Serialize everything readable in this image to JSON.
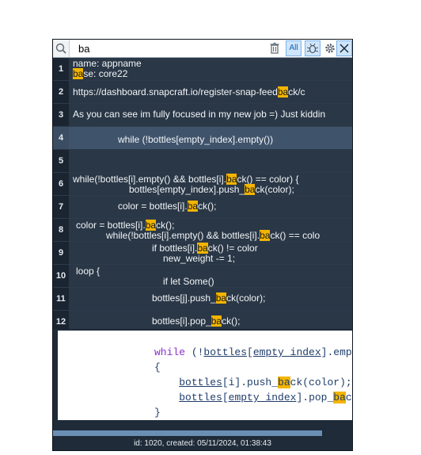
{
  "search": {
    "value": "ba",
    "all_label": "All"
  },
  "icons": {
    "search": "search-icon",
    "trash": "trash-icon",
    "bug": "bug-icon",
    "gear": "gear-icon",
    "close": "close-icon"
  },
  "rows": [
    {
      "num": "1",
      "lines": [
        [
          {
            "t": "name: appname"
          }
        ],
        [
          {
            "t": "ba",
            "h": true
          },
          {
            "t": "se: core22"
          }
        ]
      ]
    },
    {
      "num": "2",
      "lines": [
        [
          {
            "t": "https://dashboard.snapcraft.io/register-snap-feed"
          },
          {
            "t": "ba",
            "h": true
          },
          {
            "t": "ck/c"
          }
        ]
      ]
    },
    {
      "num": "3",
      "lines": [
        [
          {
            "t": "As you can see im fully focused in my new job =) Just kiddin"
          }
        ]
      ]
    },
    {
      "num": "4",
      "lines": [
        [
          {
            "t": "while (!bottles[empty_index].empty())"
          }
        ]
      ]
    },
    {
      "num": "5",
      "lines": []
    },
    {
      "num": "6",
      "lines": [
        [
          {
            "t": "while(!bottles[i].empty() && bottles[i]."
          },
          {
            "t": "ba",
            "h": true
          },
          {
            "t": "ck() == color) {"
          }
        ],
        [
          {
            "t": "bottles[empty_index].push_"
          },
          {
            "t": "ba",
            "h": true
          },
          {
            "t": "ck(color);"
          }
        ]
      ]
    },
    {
      "num": "7",
      "lines": [
        [
          {
            "t": "color = bottles[i]."
          },
          {
            "t": "ba",
            "h": true
          },
          {
            "t": "ck();"
          }
        ]
      ]
    },
    {
      "num": "8",
      "lines": [
        [
          {
            "t": "color = bottles[i]."
          },
          {
            "t": "ba",
            "h": true
          },
          {
            "t": "ck();"
          }
        ],
        [
          {
            "t": "while(!bottles[i].empty() && bottles[i]."
          },
          {
            "t": "ba",
            "h": true
          },
          {
            "t": "ck() == colo"
          }
        ]
      ]
    },
    {
      "num": "9",
      "lines": [
        [
          {
            "t": "if bottles[i]."
          },
          {
            "t": "ba",
            "h": true
          },
          {
            "t": "ck() != color"
          }
        ],
        [
          {
            "t": "new_weight -= 1;"
          }
        ]
      ]
    },
    {
      "num": "10",
      "lines": [
        [
          {
            "t": "loop {"
          }
        ],
        [
          {
            "t": "if let Some()"
          }
        ]
      ]
    },
    {
      "num": "11",
      "lines": [
        [
          {
            "t": "bottles[j].push_"
          },
          {
            "t": "ba",
            "h": true
          },
          {
            "t": "ck(color);"
          }
        ]
      ]
    },
    {
      "num": "12",
      "lines": [
        [
          {
            "t": "bottles[i].pop_"
          },
          {
            "t": "ba",
            "h": true
          },
          {
            "t": "ck();"
          }
        ]
      ]
    }
  ],
  "preview": [
    [
      {
        "c": "kw",
        "t": "while"
      },
      {
        "c": "",
        "t": " (!"
      },
      {
        "c": "var",
        "t": "bottles"
      },
      {
        "c": "",
        "t": "["
      },
      {
        "c": "var",
        "t": "empty_index"
      },
      {
        "c": "",
        "t": "].empt"
      }
    ],
    [
      {
        "c": "",
        "t": "{"
      }
    ],
    [
      {
        "c": "",
        "t": "    "
      },
      {
        "c": "var",
        "t": "bottles"
      },
      {
        "c": "",
        "t": "[i].push_"
      },
      {
        "c": "hl",
        "t": "ba"
      },
      {
        "c": "",
        "t": "ck(color);"
      }
    ],
    [
      {
        "c": "",
        "t": "    "
      },
      {
        "c": "var",
        "t": "bottles"
      },
      {
        "c": "",
        "t": "["
      },
      {
        "c": "var",
        "t": "empty_index"
      },
      {
        "c": "",
        "t": "].pop_"
      },
      {
        "c": "hl",
        "t": "ba"
      },
      {
        "c": "",
        "t": "ck"
      }
    ],
    [
      {
        "c": "",
        "t": "}"
      }
    ]
  ],
  "status": "id: 1020, created: 05/11/2024, 01:38:43",
  "colors": {
    "highlight": "#f4b400",
    "selected_row": "#3e5068",
    "background": "#1f2b38"
  }
}
